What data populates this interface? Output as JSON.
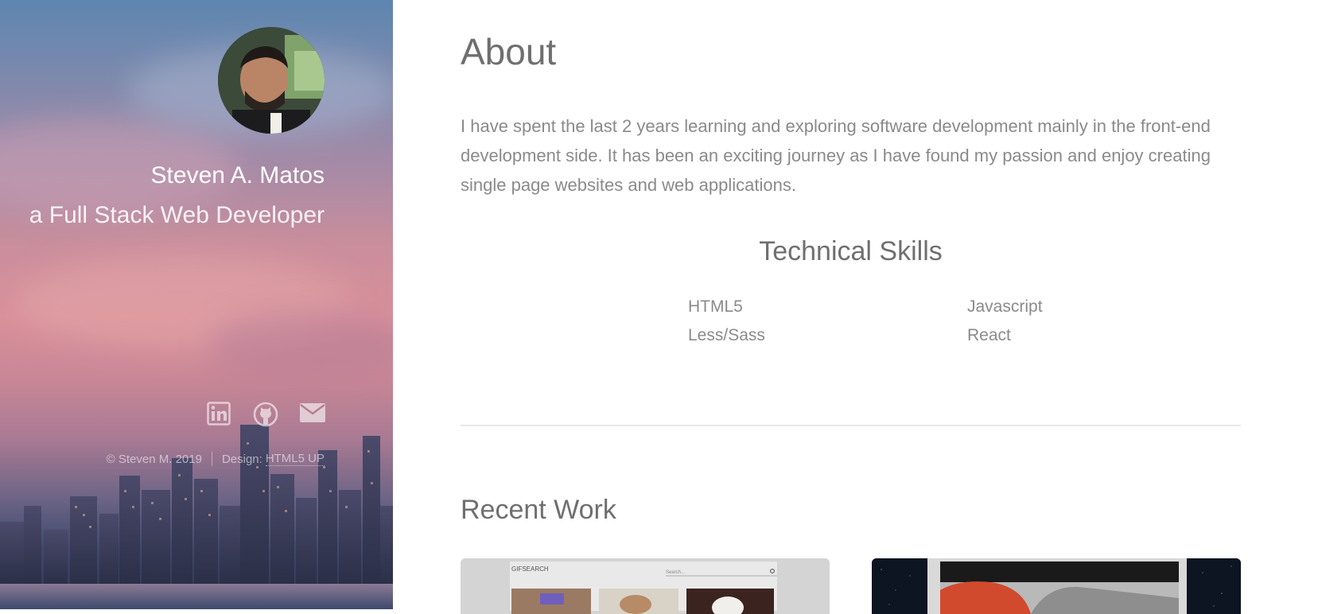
{
  "sidebar": {
    "name": "Steven A. Matos",
    "tagline": "a Full Stack Web Developer",
    "social": [
      {
        "icon": "linkedin-icon",
        "label": "LinkedIn"
      },
      {
        "icon": "github-icon",
        "label": "GitHub"
      },
      {
        "icon": "envelope-icon",
        "label": "Email"
      }
    ],
    "footer": {
      "copyright": "© Steven M. 2019",
      "design_label": "Design:",
      "design_link": "HTML5 UP"
    }
  },
  "main": {
    "about": {
      "title": "About",
      "text": "I have spent the last 2 years learning and exploring software development mainly in the front-end development side. It has been an exciting journey as I have found my passion and enjoy creating single page websites and web applications."
    },
    "skills": {
      "title": "Technical Skills",
      "items": [
        "HTML5",
        "Javascript",
        "Less/Sass",
        "React"
      ]
    },
    "recent_work": {
      "title": "Recent Work",
      "project_1_header": "GIFSEARCH",
      "project_1_search_placeholder": "Search..."
    }
  },
  "colors": {
    "heading": "#6f6f6f",
    "body_text": "#8a8a8a",
    "divider": "#e8e8e8"
  }
}
